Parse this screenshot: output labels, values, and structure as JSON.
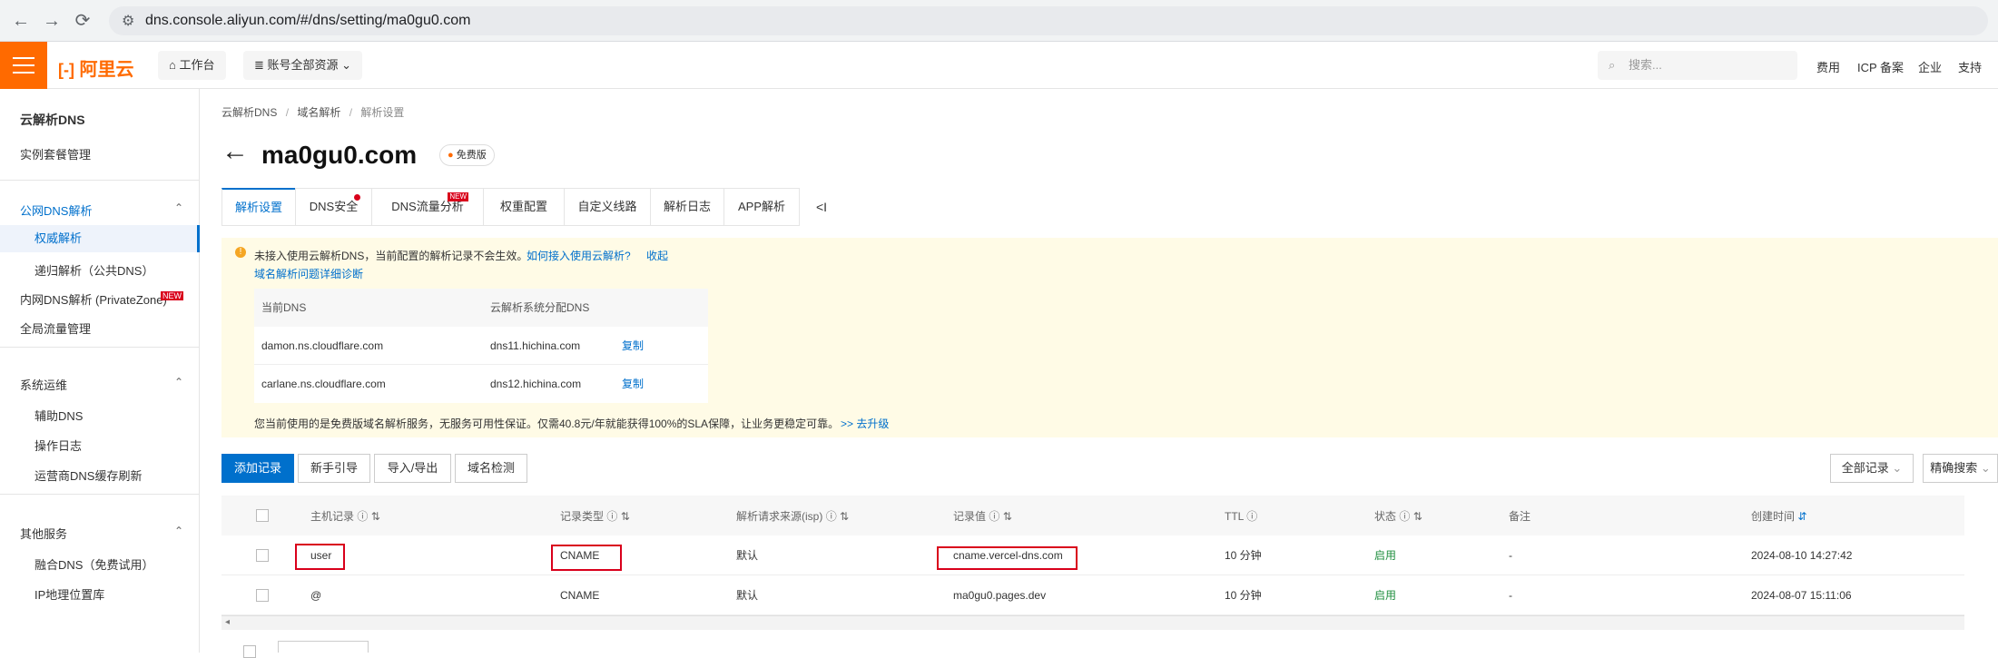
{
  "browser": {
    "url": "dns.console.aliyun.com/#/dns/setting/ma0gu0.com"
  },
  "topbar": {
    "logo": "阿里云",
    "workbench": "工作台",
    "account_resources": "账号全部资源",
    "search_placeholder": "搜索...",
    "links": [
      "费用",
      "ICP 备案",
      "企业",
      "支持"
    ]
  },
  "sidebar": {
    "title": "云解析DNS",
    "instance": "实例套餐管理",
    "groups": [
      {
        "label": "公网DNS解析",
        "items": [
          "权威解析",
          "递归解析（公共DNS）"
        ],
        "active": "权威解析"
      },
      {
        "label": "内网DNS解析 (PrivateZone)",
        "badge": "NEW"
      },
      {
        "label": "全局流量管理"
      },
      {
        "label": "系统运维",
        "items": [
          "辅助DNS",
          "操作日志",
          "运营商DNS缓存刷新"
        ]
      },
      {
        "label": "其他服务",
        "items": [
          "融合DNS（免费试用）",
          "IP地理位置库"
        ]
      }
    ]
  },
  "breadcrumb": [
    "云解析DNS",
    "域名解析",
    "解析设置"
  ],
  "domain": {
    "name": "ma0gu0.com",
    "edition": "免费版"
  },
  "tabs": [
    {
      "label": "解析设置",
      "active": true
    },
    {
      "label": "DNS安全",
      "dot": true
    },
    {
      "label": "DNS流量分析",
      "badge": "NEW"
    },
    {
      "label": "权重配置"
    },
    {
      "label": "自定义线路"
    },
    {
      "label": "解析日志"
    },
    {
      "label": "APP解析"
    }
  ],
  "notice": {
    "message": "未接入使用云解析DNS，当前配置的解析记录不会生效。",
    "link1": "如何接入使用云解析?",
    "link2": "收起",
    "diagnose": "域名解析问题详细诊断",
    "table_headers": [
      "当前DNS",
      "云解析系统分配DNS"
    ],
    "rows": [
      {
        "current": "damon.ns.cloudflare.com",
        "assigned": "dns11.hichina.com",
        "action": "复制"
      },
      {
        "current": "carlane.ns.cloudflare.com",
        "assigned": "dns12.hichina.com",
        "action": "复制"
      }
    ],
    "sla_text": "您当前使用的是免费版域名解析服务，无服务可用性保证。仅需40.8元/年就能获得100%的SLA保障，让业务更稳定可靠。",
    "upgrade": ">> 去升级"
  },
  "actions": {
    "add_record": "添加记录",
    "guide": "新手引导",
    "import_export": "导入/导出",
    "detect": "域名检测",
    "all_records": "全部记录",
    "precise_search": "精确搜索"
  },
  "table": {
    "headers": [
      "主机记录",
      "记录类型",
      "解析请求来源(isp)",
      "记录值",
      "TTL",
      "状态",
      "备注",
      "创建时间"
    ],
    "rows": [
      {
        "host": "user",
        "type": "CNAME",
        "isp": "默认",
        "value": "cname.vercel-dns.com",
        "ttl": "10 分钟",
        "status": "启用",
        "note": "-",
        "created": "2024-08-10 14:27:42"
      },
      {
        "host": "@",
        "type": "CNAME",
        "isp": "默认",
        "value": "ma0gu0.pages.dev",
        "ttl": "10 分钟",
        "status": "启用",
        "note": "-",
        "created": "2024-08-07 15:11:06"
      }
    ]
  },
  "colors": {
    "brand": "#ff6a00",
    "primary": "#0070cc",
    "notice_bg": "#fffbe6",
    "status_green": "#1e8e3e",
    "highlight_red": "#d9001b"
  }
}
